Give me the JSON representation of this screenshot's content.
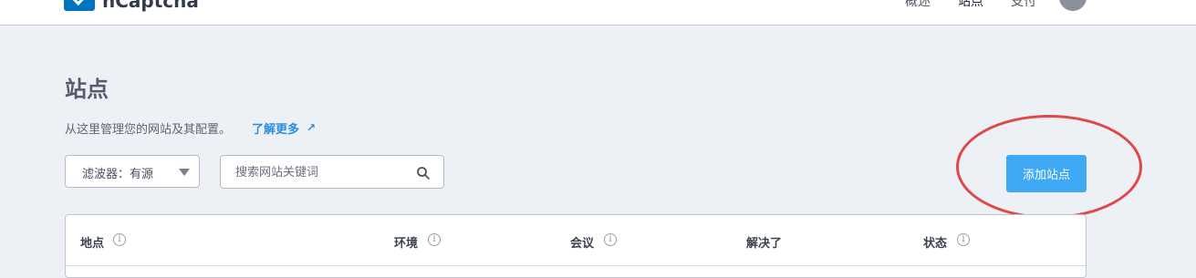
{
  "header": {
    "logo_text": "hCaptcha",
    "nav": [
      {
        "label": "概述"
      },
      {
        "label": "站点"
      },
      {
        "label": "支付"
      }
    ]
  },
  "page": {
    "title": "站点",
    "subtitle": "从这里管理您的网站及其配置。",
    "learn_more": "了解更多",
    "learn_more_arrow": "↗"
  },
  "filter": {
    "label": "滤波器：有源"
  },
  "search": {
    "placeholder": "搜索网站关键词",
    "value": ""
  },
  "add_button": {
    "label": "添加站点"
  },
  "table": {
    "columns": [
      {
        "label": "地点",
        "info": true
      },
      {
        "label": "环境",
        "info": true
      },
      {
        "label": "会议",
        "info": true
      },
      {
        "label": "解决了",
        "info": false
      },
      {
        "label": "状态",
        "info": true
      }
    ]
  },
  "colors": {
    "accent": "#3fa9f5",
    "link": "#2a8fe0",
    "highlight": "#e04848",
    "background": "#edf0f4"
  }
}
